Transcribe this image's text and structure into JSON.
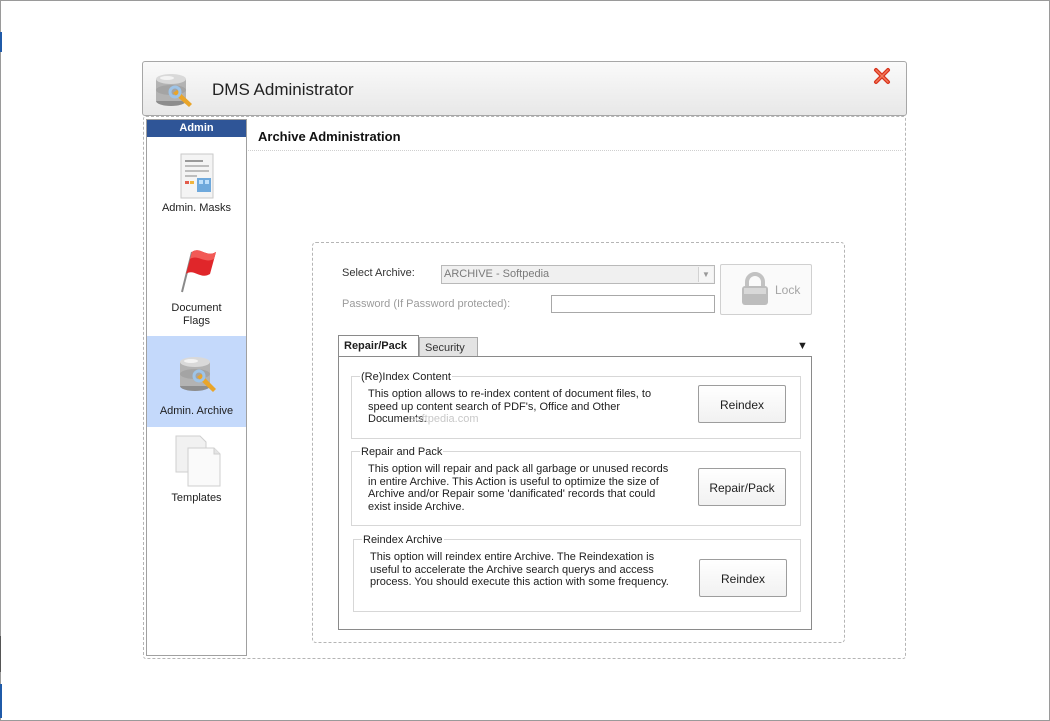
{
  "window": {
    "title": "DMS Administrator"
  },
  "sidebar": {
    "header": "Admin",
    "items": [
      {
        "label": "Admin. Masks",
        "icon": "document-masks-icon"
      },
      {
        "label": "Document Flags",
        "line1": "Document",
        "line2": "Flags",
        "icon": "red-flag-icon"
      },
      {
        "label": "Admin. Archive",
        "icon": "database-wrench-icon",
        "selected": true
      },
      {
        "label": "Templates",
        "icon": "templates-pages-icon"
      }
    ]
  },
  "content": {
    "title": "Archive Administration",
    "select_archive_label": "Select Archive:",
    "select_archive_value": "ARCHIVE - Softpedia",
    "password_label": "Password (If Password protected):",
    "password_value": "",
    "lock_label": "Lock",
    "tabs": [
      {
        "label": "Repair/Pack",
        "active": true
      },
      {
        "label": "Security",
        "active": false
      }
    ],
    "groups": [
      {
        "title": "(Re)Index Content",
        "description": "This option allows to re-index content of document files, to speed up content search of PDF's, Office and Other Documents.",
        "button": "Reindex"
      },
      {
        "title": "Repair and Pack",
        "description": "This option will repair and pack all garbage or unused records in entire Archive. This Action is useful to optimize the size of Archive and/or Repair some 'danificated' records that could exist inside Archive.",
        "button": "Repair/Pack"
      },
      {
        "title": "Reindex Archive",
        "description": "This option will reindex entire Archive. The Reindexation is useful to accelerate the Archive search querys and access process. You should execute this action with some frequency.",
        "button": "Reindex"
      }
    ],
    "watermark": "softpedia.com"
  },
  "colors": {
    "sidebar_header": "#2f5597",
    "selected_item": "#c4d9fb",
    "close": "#d8321c"
  }
}
